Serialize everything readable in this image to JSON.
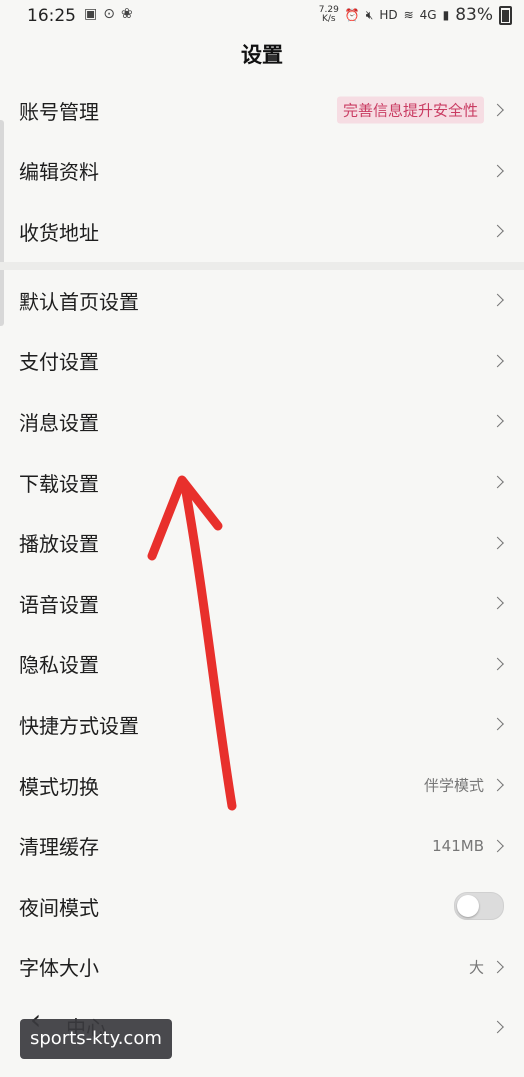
{
  "status_bar": {
    "time": "16:25",
    "left_icons": [
      "image-icon",
      "circle-dot-icon",
      "paw-icon"
    ],
    "network_speed": "7.29\nK/s",
    "hd": "HD",
    "network_type": "4G",
    "battery_percent": "83%"
  },
  "header": {
    "title": "设置"
  },
  "groups": [
    {
      "items": [
        {
          "label": "账号管理",
          "badge": "完善信息提升安全性"
        },
        {
          "label": "编辑资料"
        },
        {
          "label": "收货地址"
        }
      ]
    },
    {
      "items": [
        {
          "label": "默认首页设置"
        },
        {
          "label": "支付设置"
        },
        {
          "label": "消息设置"
        },
        {
          "label": "下载设置"
        },
        {
          "label": "播放设置"
        },
        {
          "label": "语音设置"
        },
        {
          "label": "隐私设置"
        },
        {
          "label": "快捷方式设置"
        },
        {
          "label": "模式切换",
          "value": "伴学模式"
        },
        {
          "label": "清理缓存",
          "value": "141MB"
        },
        {
          "label": "夜间模式",
          "toggle": false
        },
        {
          "label": "字体大小",
          "value": "大"
        }
      ]
    }
  ],
  "bottom": {
    "back_symbol": "‹",
    "partial_label": "中心"
  },
  "watermark": "sports-kty.com",
  "colors": {
    "background": "#f7f7f5",
    "badge_bg": "#f6dde3",
    "badge_text": "#c93c62",
    "annotation_arrow": "#e8302c"
  }
}
